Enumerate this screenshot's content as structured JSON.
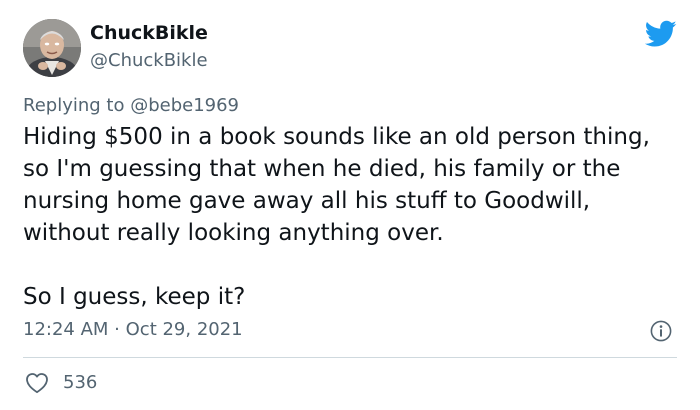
{
  "author": {
    "display_name": "ChuckBikle",
    "handle": "@ChuckBikle",
    "avatar_icon": "profile-photo"
  },
  "reply": {
    "prefix": "Replying to ",
    "mention": "@bebe1969"
  },
  "body": {
    "paragraph_1": "Hiding $500 in a book sounds like an old person thing, so I'm guessing that when he died, his family or the nursing home gave away all his stuff to Goodwill, without really looking anything over.",
    "paragraph_2": "So I guess, keep it?"
  },
  "meta": {
    "time": "12:24 AM",
    "separator": " · ",
    "date": "Oct 29, 2021"
  },
  "engagement": {
    "likes": "536"
  },
  "icons": {
    "brand": "twitter-bird-icon",
    "info": "info-icon",
    "like": "heart-icon"
  },
  "colors": {
    "brand_blue": "#1d9bf0",
    "secondary_text": "#536471",
    "primary_text": "#0f1419",
    "divider": "#cfd9de"
  }
}
